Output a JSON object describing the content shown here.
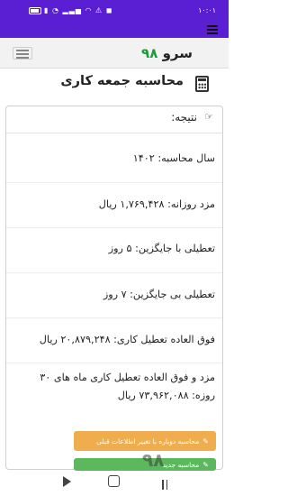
{
  "status_bar": {
    "time": "۱۰:۰۱",
    "icons": "▮ ◔ ▂▃▅ ◠ ⚠ ◼"
  },
  "navbar": {
    "logo_text": "سرو ",
    "logo_number": "۹۸"
  },
  "page": {
    "title": "محاسبه جمعه کاری"
  },
  "result": {
    "heading": "نتیجه:",
    "rows": [
      "سال محاسبه: ۱۴۰۲",
      "مزد روزانه: ۱,۷۶۹,۴۲۸ ریال",
      "تعطیلی با جایگزین: ۵ روز",
      "تعطیلی بی جایگزین: ۷ روز",
      "فوق العاده تعطیل کاری: ۲۰,۸۷۹,۲۴۸ ریال",
      "مزد و فوق العاده تعطیل کاری ماه های ۳۰ روزه: ۷۳,۹۶۲,۰۸۸ ریال"
    ]
  },
  "buttons": {
    "recalc_label": "محاسبه دوباره با تغییر اطلاعات قبلی",
    "new_calc_label": "محاسبه جدید"
  },
  "overlay": {
    "logo": "۹۸"
  },
  "colors": {
    "status_bar": "#5b1fd3",
    "logo_accent": "#1e9b3a",
    "orange_button": "#f0ad4e",
    "green_button": "#5cb85c"
  }
}
